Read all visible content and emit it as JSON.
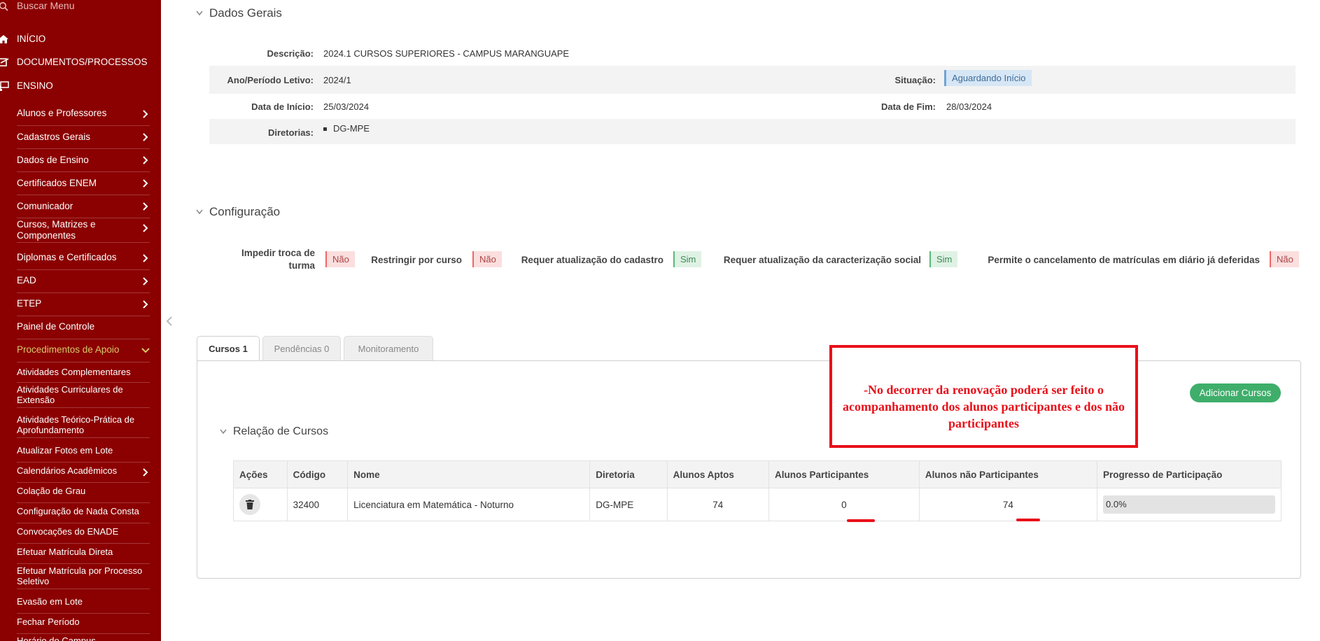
{
  "sidebar": {
    "search_placeholder": "Buscar Menu",
    "top_items": [
      {
        "label": "INÍCIO",
        "icon": "home-icon"
      },
      {
        "label": "DOCUMENTOS/PROCESSOS",
        "icon": "documents-icon"
      },
      {
        "label": "ENSINO",
        "icon": "teaching-icon"
      }
    ],
    "items": [
      {
        "label": "Alunos e Professores",
        "has_children": true
      },
      {
        "label": "Cadastros Gerais",
        "has_children": true
      },
      {
        "label": "Dados de Ensino",
        "has_children": true
      },
      {
        "label": "Certificados ENEM",
        "has_children": true
      },
      {
        "label": "Comunicador",
        "has_children": true
      },
      {
        "label": "Cursos, Matrizes e Componentes",
        "has_children": true
      },
      {
        "label": "Diplomas e Certificados",
        "has_children": true
      },
      {
        "label": "EAD",
        "has_children": true
      },
      {
        "label": "ETEP",
        "has_children": true
      },
      {
        "label": "Painel de Controle",
        "has_children": false
      },
      {
        "label": "Procedimentos de Apoio",
        "has_children": true,
        "active": true
      }
    ],
    "subitems": [
      {
        "label": "Atividades Complementares"
      },
      {
        "label": "Atividades Curriculares de Extensão"
      },
      {
        "label": "Atividades Teórico-Prática de Aprofundamento"
      },
      {
        "label": "Atualizar Fotos em Lote"
      },
      {
        "label": "Calendários Acadêmicos",
        "has_children": true
      },
      {
        "label": "Colação de Grau"
      },
      {
        "label": "Configuração de Nada Consta"
      },
      {
        "label": "Convocações do ENADE"
      },
      {
        "label": "Efetuar Matrícula Direta"
      },
      {
        "label": "Efetuar Matrícula por Processo Seletivo"
      },
      {
        "label": "Evasão em Lote"
      },
      {
        "label": "Fechar Período"
      },
      {
        "label": "Horário do Campus"
      }
    ],
    "colors": {
      "background": "#8b0000",
      "active_text": "#d8c76b"
    }
  },
  "dados_gerais": {
    "title": "Dados Gerais",
    "descricao_label": "Descrição:",
    "descricao": "2024.1 CURSOS SUPERIORES - CAMPUS MARANGUAPE",
    "ano_label": "Ano/Período Letivo:",
    "ano": "2024/1",
    "situacao_label": "Situação:",
    "situacao": "Aguardando Início",
    "data_inicio_label": "Data de Início:",
    "data_inicio": "25/03/2024",
    "data_fim_label": "Data de Fim:",
    "data_fim": "28/03/2024",
    "diretorias_label": "Diretorias:",
    "diretorias": [
      "DG-MPE"
    ]
  },
  "configuracao": {
    "title": "Configuração",
    "items": [
      {
        "label": "Impedir troca de turma",
        "value": "Não"
      },
      {
        "label": "Restringir por curso",
        "value": "Não"
      },
      {
        "label": "Requer atualização do cadastro",
        "value": "Sim"
      },
      {
        "label": "Requer atualização da caracterização social",
        "value": "Sim"
      },
      {
        "label": "Permite o cancelamento de matrículas em diário já deferidas",
        "value": "Não"
      }
    ]
  },
  "tabs": [
    {
      "label": "Cursos 1",
      "active": true
    },
    {
      "label": "Pendências 0",
      "active": false
    },
    {
      "label": "Monitoramento",
      "active": false
    }
  ],
  "add_button": "Adicionar Cursos",
  "annotation": "-No decorrer da renovação poderá ser feito o acompanhamento dos alunos participantes e dos não participantes",
  "relacao": {
    "title": "Relação de Cursos",
    "columns": [
      "Ações",
      "Código",
      "Nome",
      "Diretoria",
      "Alunos Aptos",
      "Alunos Participantes",
      "Alunos não Participantes",
      "Progresso de Participação"
    ],
    "rows": [
      {
        "codigo": "32400",
        "nome": "Licenciatura em Matemática - Noturno",
        "diretoria": "DG-MPE",
        "aptos": "74",
        "participantes": "0",
        "nao_participantes": "74",
        "progresso": "0.0%",
        "progresso_fraction": 0.0
      }
    ]
  }
}
